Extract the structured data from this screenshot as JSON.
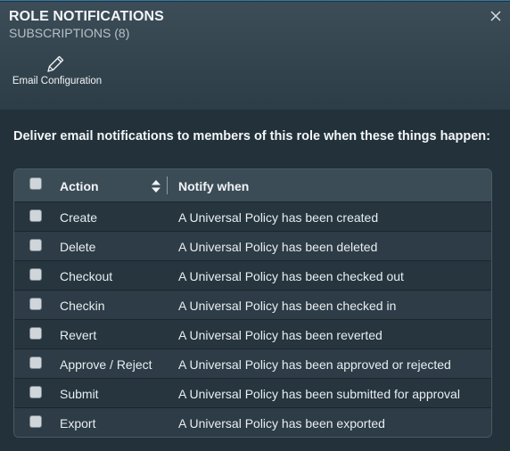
{
  "dialog": {
    "title": "ROLE NOTIFICATIONS",
    "subtitle": "SUBSCRIPTIONS (8)",
    "close_icon": "close-icon"
  },
  "toolbar": {
    "email_config_label": "Email Configuration",
    "email_config_icon": "pencil-icon"
  },
  "instructions": "Deliver email notifications to members of this role when these things happen:",
  "table": {
    "columns": [
      "Action",
      "Notify when"
    ],
    "rows": [
      {
        "action": "Create",
        "notify": "A Universal Policy has been created",
        "checked": false
      },
      {
        "action": "Delete",
        "notify": "A Universal Policy has been deleted",
        "checked": false
      },
      {
        "action": "Checkout",
        "notify": "A Universal Policy has been checked out",
        "checked": false
      },
      {
        "action": "Checkin",
        "notify": "A Universal Policy has been checked in",
        "checked": false
      },
      {
        "action": "Revert",
        "notify": "A Universal Policy has been reverted",
        "checked": false
      },
      {
        "action": "Approve / Reject",
        "notify": "A Universal Policy has been approved or rejected",
        "checked": false
      },
      {
        "action": "Submit",
        "notify": "A Universal Policy has been submitted for approval",
        "checked": false
      },
      {
        "action": "Export",
        "notify": "A Universal Policy has been exported",
        "checked": false
      }
    ]
  },
  "colors": {
    "header_bg": "#3b4c57",
    "body_bg": "#22313a",
    "accent_border": "#2f79a8"
  }
}
